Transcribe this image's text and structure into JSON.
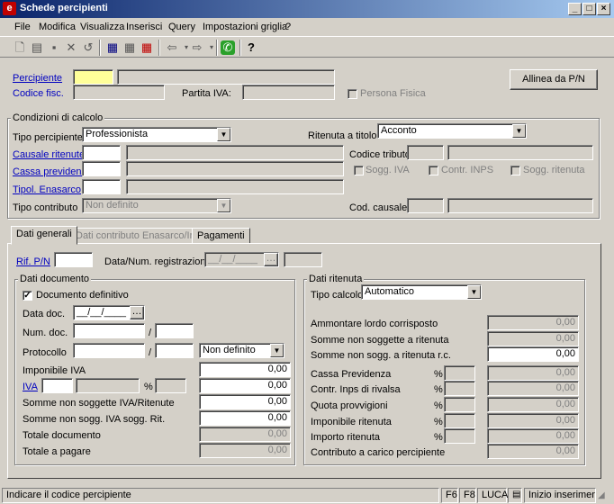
{
  "window": {
    "title": "Schede percipienti",
    "icon": "e"
  },
  "menu": [
    "File",
    "Modifica",
    "Visualizza",
    "Inserisci",
    "Query",
    "Impostazioni griglia",
    "?"
  ],
  "header": {
    "percipiente_label": "Percipiente",
    "codice_fisc_label": "Codice fisc.",
    "partita_iva_label": "Partita IVA:",
    "persona_fisica_label": "Persona Fisica",
    "allinea_button": "Allinea da P/N"
  },
  "condizioni": {
    "title": "Condizioni di calcolo",
    "tipo_percipiente_label": "Tipo percipiente",
    "tipo_percipiente_value": "Professionista",
    "ritenuta_titolo_label": "Ritenuta a titolo",
    "ritenuta_titolo_value": "Acconto",
    "causale_label": "Causale ritenute",
    "codice_tributo_label": "Codice tributo",
    "cassa_label": "Cassa previdenza",
    "sogg_iva_label": "Sogg. IVA",
    "contr_inps_label": "Contr. INPS",
    "sogg_ritenuta_label": "Sogg. ritenuta",
    "enasarco_label": "Tipol. Enasarco",
    "tipo_contributo_label": "Tipo contributo",
    "tipo_contributo_value": "Non definito",
    "cod_causale_label": "Cod. causale"
  },
  "tabs": [
    "Dati generali",
    "Dati contributo Enasarco/Inps",
    "Pagamenti"
  ],
  "general": {
    "rif_pn_label": "Rif. P/N",
    "data_num_label": "Data/Num. registrazione",
    "data_num_value": "__/__/____"
  },
  "documento": {
    "title": "Dati documento",
    "definitivo_label": "Documento definitivo",
    "data_doc_label": "Data doc.",
    "data_doc_value": "__/__/____",
    "num_doc_label": "Num. doc.",
    "protocollo_label": "Protocollo",
    "protocollo_select": "Non definito",
    "imponibile_iva_label": "Imponibile IVA",
    "imponibile_iva_value": "0,00",
    "iva_label": "IVA",
    "percent": "%",
    "iva_value": "0,00",
    "somme_non_sogg_iva_label": "Somme non soggette IVA/Ritenute",
    "somme_non_sogg_iva_value": "0,00",
    "somme_non_sogg_iva_rit_label": "Somme non sogg. IVA sogg. Rit.",
    "somme_non_sogg_iva_rit_value": "0,00",
    "totale_documento_label": "Totale documento",
    "totale_documento_value": "0,00",
    "totale_pagare_label": "Totale a pagare",
    "totale_pagare_value": "0,00",
    "slash": "/"
  },
  "ritenuta": {
    "title": "Dati ritenuta",
    "tipo_calcolo_label": "Tipo calcolo",
    "tipo_calcolo_value": "Automatico",
    "rows": [
      {
        "label": "Ammontare lordo corrisposto",
        "value": "0,00",
        "editable": false,
        "pct": false
      },
      {
        "label": "Somme non soggette a ritenuta",
        "value": "0,00",
        "editable": false,
        "pct": false
      },
      {
        "label": "Somme non sogg. a ritenuta r.c.",
        "value": "0,00",
        "editable": true,
        "pct": false
      },
      {
        "label": "Cassa Previdenza",
        "value": "0,00",
        "editable": false,
        "pct": true
      },
      {
        "label": "Contr. Inps di rivalsa",
        "value": "0,00",
        "editable": false,
        "pct": true
      },
      {
        "label": "Quota provvigioni",
        "value": "0,00",
        "editable": false,
        "pct": true
      },
      {
        "label": "Imponibile ritenuta",
        "value": "0,00",
        "editable": false,
        "pct": true
      },
      {
        "label": "Importo ritenuta",
        "value": "0,00",
        "editable": false,
        "pct": true
      },
      {
        "label": "Contributo a carico percipiente",
        "value": "0,00",
        "editable": false,
        "pct": false
      }
    ],
    "percent": "%"
  },
  "status": {
    "message": "Indicare il codice percipiente",
    "f6": "F6",
    "f8": "F8",
    "user": "LUCA",
    "mode": "Inizio inserimento..."
  }
}
